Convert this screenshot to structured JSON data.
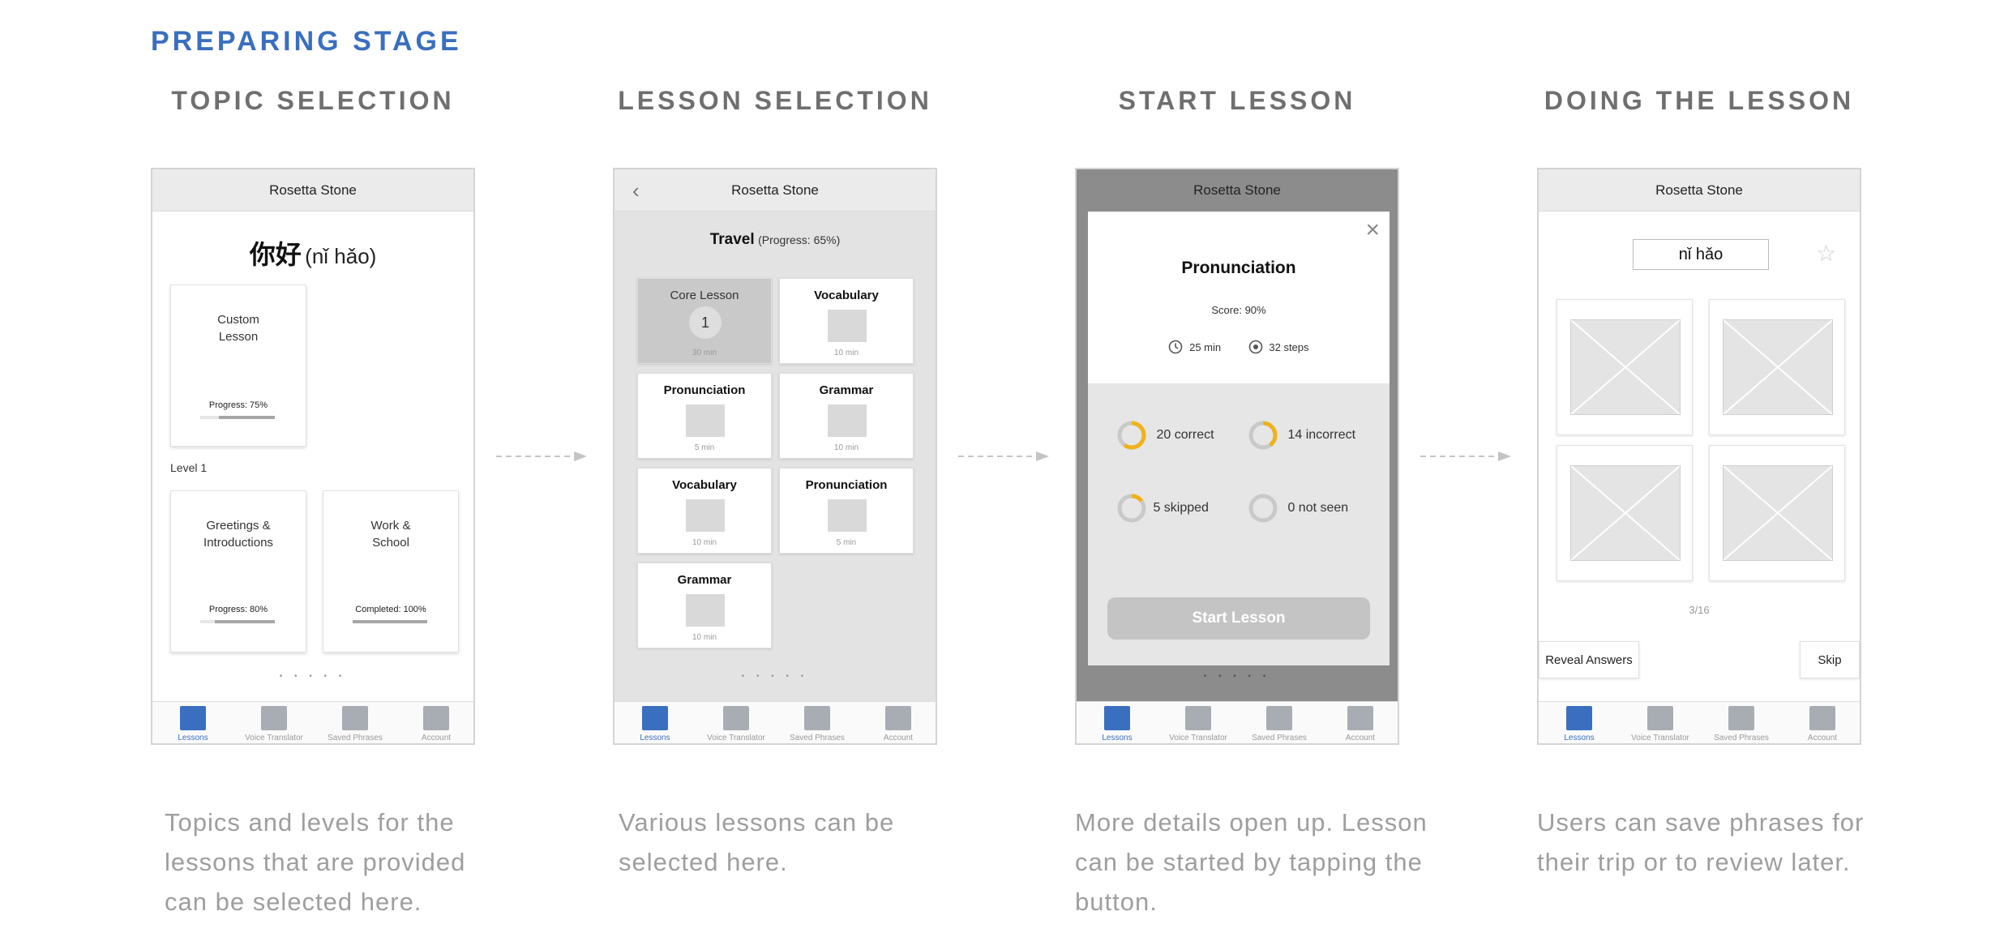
{
  "stage_title": "PREPARING STAGE",
  "colors": {
    "accent": "#3a6fbf",
    "donut": "#f0b21a",
    "title_gray": "#6f6f6f"
  },
  "tabbar": {
    "items": [
      "Lessons",
      "Voice Translator",
      "Saved Phrases",
      "Account"
    ]
  },
  "steps": [
    {
      "title": "TOPIC SELECTION",
      "description": [
        "Topics and levels for the",
        "lessons that are provided",
        "can be selected here."
      ]
    },
    {
      "title": "LESSON SELECTION",
      "description": [
        "Various lessons can be",
        "selected here."
      ]
    },
    {
      "title": "START LESSON",
      "description": [
        "More details open up. Lesson",
        "can be started by tapping the",
        "button."
      ]
    },
    {
      "title": "DOING THE LESSON",
      "description": [
        "Users can save phrases for",
        "their trip or to review later."
      ]
    }
  ],
  "topic_screen": {
    "app_title": "Rosetta Stone",
    "greeting": "你好",
    "pinyin": "(nǐ hǎo)",
    "custom_lesson": {
      "title": [
        "Custom",
        "Lesson"
      ],
      "progress_label": "Progress: 75%",
      "progress": 0.75
    },
    "level_label": "Level 1",
    "topics": [
      {
        "title": [
          "Greetings &",
          "Introductions"
        ],
        "progress_label": "Progress: 80%",
        "progress": 0.8
      },
      {
        "title": [
          "Work &",
          "School"
        ],
        "progress_label": "Completed: 100%",
        "progress": 1.0
      }
    ],
    "page_dots": "• • • • •"
  },
  "lesson_screen": {
    "app_title": "Rosetta Stone",
    "topic": "Travel",
    "topic_progress": "(Progress: 65%)",
    "lessons": [
      {
        "title": "Core Lesson",
        "number": "1",
        "duration": "30 min",
        "selected": true
      },
      {
        "title": "Vocabulary",
        "duration": "10 min"
      },
      {
        "title": "Pronunciation",
        "duration": "5 min"
      },
      {
        "title": "Grammar",
        "duration": "10 min"
      },
      {
        "title": "Vocabulary",
        "duration": "10 min"
      },
      {
        "title": "Pronunciation",
        "duration": "5 min"
      },
      {
        "title": "Grammar",
        "duration": "10 min"
      }
    ],
    "page_dots": "• • • • •"
  },
  "start_screen": {
    "app_title": "Rosetta Stone",
    "lesson_title": "Pronunciation",
    "score": "Score: 90%",
    "duration": "25 min",
    "steps": "32 steps",
    "stats": [
      {
        "label": "20 correct",
        "fraction": 0.6
      },
      {
        "label": "14 incorrect",
        "fraction": 0.4
      },
      {
        "label": "5 skipped",
        "fraction": 0.15
      },
      {
        "label": "0 not seen",
        "fraction": 0
      }
    ],
    "start_button": "Start Lesson",
    "page_dots": "• • • • •"
  },
  "doing_screen": {
    "app_title": "Rosetta Stone",
    "phrase": "nǐ hǎo",
    "counter": "3/16",
    "reveal_button": "Reveal Answers",
    "skip_button": "Skip"
  }
}
